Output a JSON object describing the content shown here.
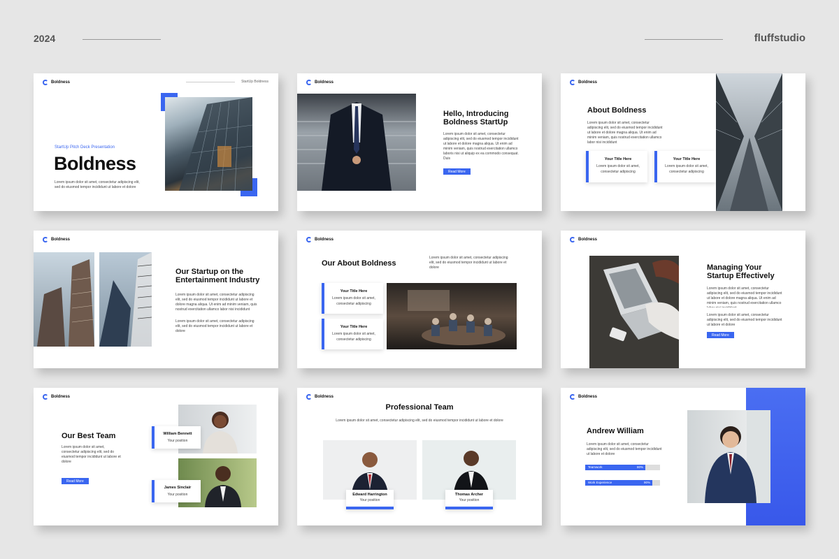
{
  "header": {
    "year": "2024",
    "brand": "fluffstudio"
  },
  "brand_name": "Boldness",
  "lorem_long": "Lorem ipsum dolor sit amet, consectetur adipiscing elit, sed do eiusmod tempor incididunt ut labore et dolore magna aliqua. Ut enim ad minim veniam, quis nostrud exercitation ullamco laboris nisi ut aliquip ex ea commodo consequat. Duis",
  "lorem_med": "Lorem ipsum dolor sit amet, consectetur adipiscing elit, sed do eiusmod tempor incididunt ut labore et dolore magna aliqua. Ut enim ad minim veniam, quis nostrud exercitation ullamco labor nisi incididunt",
  "lorem_short": "Lorem ipsum dolor sit amet, consectetur adipiscing elit, sed do eiusmod tempor incididunt ut labore et dolore",
  "lorem_card": "Lorem ipsum dolor sit amet, consectetur adipiscing",
  "card_title": "Your Title Here",
  "read_more": "Read More",
  "your_position": "Your position",
  "s1": {
    "tag": "StartUp Boldness",
    "subtitle": "StartUp Pitch Deck Presentation",
    "title": "Boldness"
  },
  "s2": {
    "title_1": "Hello, Introducing",
    "title_2": "Boldness StartUp"
  },
  "s3": {
    "title": "About Boldness"
  },
  "s4": {
    "title_1": "Our Startup on the",
    "title_2": "Entertainment Industry"
  },
  "s5": {
    "title": "Our About Boldness"
  },
  "s6": {
    "title_1": "Managing Your",
    "title_2": "Startup  Effectively"
  },
  "s7": {
    "title": "Our Best Team",
    "member_1": "William Bennett",
    "member_2": "James Sinclair"
  },
  "s8": {
    "title": "Professional Team",
    "member_1": "Edward Harrington",
    "member_2": "Thomas Archer"
  },
  "s9": {
    "name": "Andrew William",
    "bars": [
      {
        "label": "Teamwork",
        "pct": "80%",
        "value": 0.8
      },
      {
        "label": "Work Experience",
        "pct": "90%",
        "value": 0.9
      }
    ]
  },
  "colors": {
    "accent": "#3a66f0",
    "background": "#e6e6e6"
  }
}
